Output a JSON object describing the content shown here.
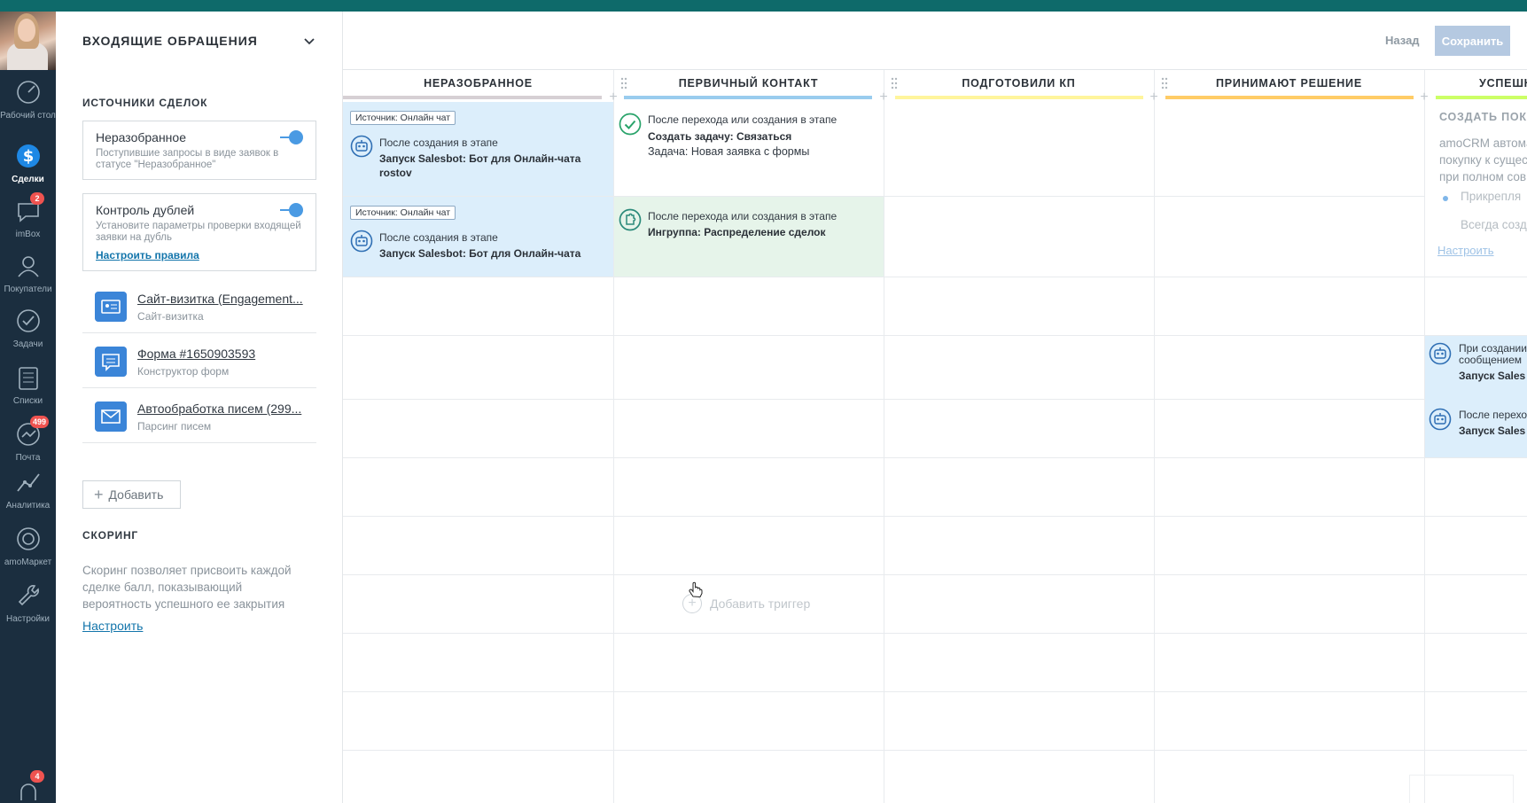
{
  "nav": {
    "items": [
      {
        "label": "Рабочий стол",
        "icon": "speedometer-icon"
      },
      {
        "label": "Сделки",
        "icon": "dollar-icon",
        "active": true
      },
      {
        "label": "imBox",
        "icon": "chat-icon",
        "badge": "2"
      },
      {
        "label": "Покупатели",
        "icon": "customers-icon"
      },
      {
        "label": "Задачи",
        "icon": "check-icon"
      },
      {
        "label": "Списки",
        "icon": "list-icon"
      },
      {
        "label": "Почта",
        "icon": "mail-icon",
        "badge": "499"
      },
      {
        "label": "Аналитика",
        "icon": "analytics-icon"
      },
      {
        "label": "amoМаркет",
        "icon": "market-icon"
      },
      {
        "label": "Настройки",
        "icon": "wrench-icon"
      }
    ],
    "bottom_badge": "4"
  },
  "panel": {
    "pipeline_title": "ВХОДЯЩИЕ ОБРАЩЕНИЯ",
    "sources_title": "ИСТОЧНИКИ СДЕЛОК",
    "unsorted": {
      "name": "Неразобранное",
      "desc": "Поступившие запросы в виде заявок в статусе \"Неразобранное\""
    },
    "duplicates": {
      "name": "Контроль дублей",
      "desc": "Установите параметры проверки входящей заявки на дубль",
      "link": "Настроить правила"
    },
    "sources": [
      {
        "name": "Сайт-визитка (Engagement...",
        "type": "Сайт-визитка",
        "icon": "card-icon"
      },
      {
        "name": "Форма #1650903593",
        "type": "Конструктор форм",
        "icon": "form-icon"
      },
      {
        "name": "Автообработка писем (299...",
        "type": "Парсинг писем",
        "icon": "envelope-icon"
      }
    ],
    "add_label": "Добавить",
    "scoring_title": "СКОРИНГ",
    "scoring_desc": "Скоринг позволяет присвоить каждой сделке балл, показывающий вероятность успешного ее закрытия",
    "scoring_link": "Настроить"
  },
  "header": {
    "back_label": "Назад",
    "save_label": "Сохранить"
  },
  "columns": [
    {
      "title": "НЕРАЗОБРАННОЕ",
      "color": "#d6d0d4"
    },
    {
      "title": "ПЕРВИЧНЫЙ КОНТАКТ",
      "color": "#99ccee"
    },
    {
      "title": "ПОДГОТОВИЛИ КП",
      "color": "#fff59c"
    },
    {
      "title": "ПРИНИМАЮТ РЕШЕНИЕ",
      "color": "#ffcc66"
    },
    {
      "title": "УСПЕШН",
      "color": "#ccff66"
    }
  ],
  "triggers": {
    "c1r1": {
      "tag": "Источник: Онлайн чат",
      "t1": "После создания в этапе",
      "t2": "Запуск Salesbot: Бот для Онлайн-чата rostov"
    },
    "c1r2": {
      "tag": "Источник: Онлайн чат",
      "t1": "После создания в этапе",
      "t2": "Запуск Salesbot: Бот для Онлайн-чата"
    },
    "c2r1": {
      "t1": "После перехода или создания в этапе",
      "t2": "Создать задачу: Связаться",
      "t3": "Задача: Новая заявка с формы"
    },
    "c2r2": {
      "t1": "После перехода или создания в этапе",
      "t2": "Ингруппа: Распределение сделок"
    },
    "c5r5": {
      "t1": "При создании",
      "t1b": "сообщением",
      "t2": "Запуск Sales"
    },
    "c5r6": {
      "t1": "После перехо",
      "t2": "Запуск Sales"
    }
  },
  "partial": {
    "title": "СОЗДАТЬ ПОКУ",
    "desc": [
      "amoCRM автома",
      "покупку к сущес",
      "при полном сов"
    ],
    "opt1": "Прикрепля",
    "opt2": "Всегда созд",
    "link": "Настроить"
  },
  "add_trigger_label": "Добавить триггер"
}
